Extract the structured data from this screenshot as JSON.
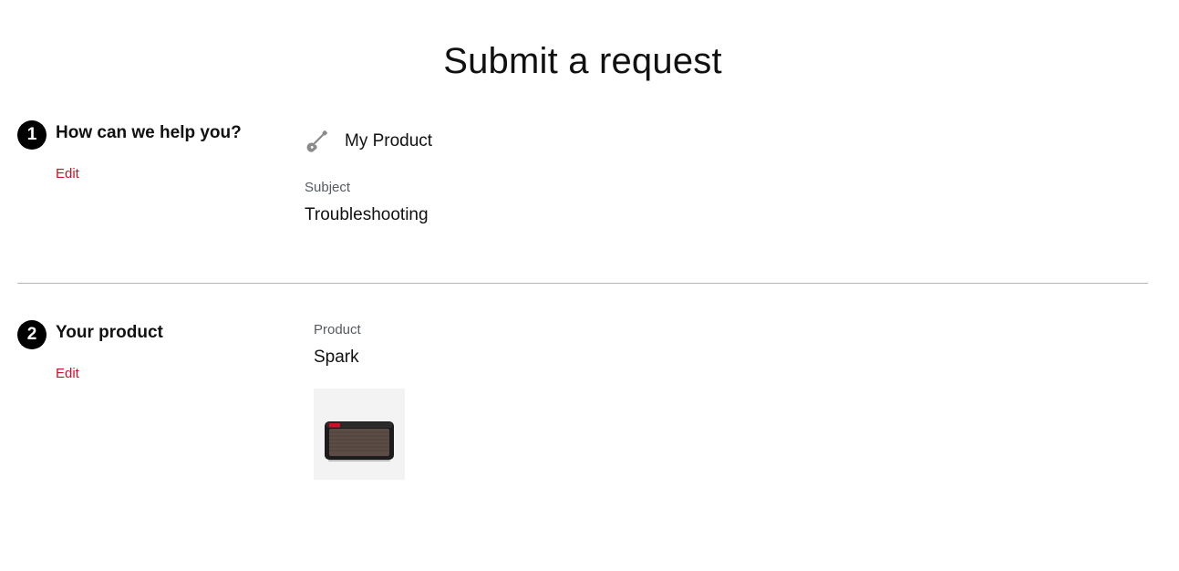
{
  "page": {
    "title": "Submit a request"
  },
  "steps": [
    {
      "number": "1",
      "title": "How can we help you?",
      "edit_label": "Edit",
      "category": {
        "icon": "guitar-icon",
        "label": "My Product"
      },
      "subject": {
        "label": "Subject",
        "value": "Troubleshooting"
      }
    },
    {
      "number": "2",
      "title": "Your product",
      "edit_label": "Edit",
      "product": {
        "label": "Product",
        "value": "Spark",
        "image": "amplifier-image"
      }
    }
  ],
  "colors": {
    "accent": "#d0102a",
    "badge": "#000000",
    "divider": "#b5b5b5",
    "muted_label": "#555a63",
    "image_bg": "#f3f3f3"
  }
}
